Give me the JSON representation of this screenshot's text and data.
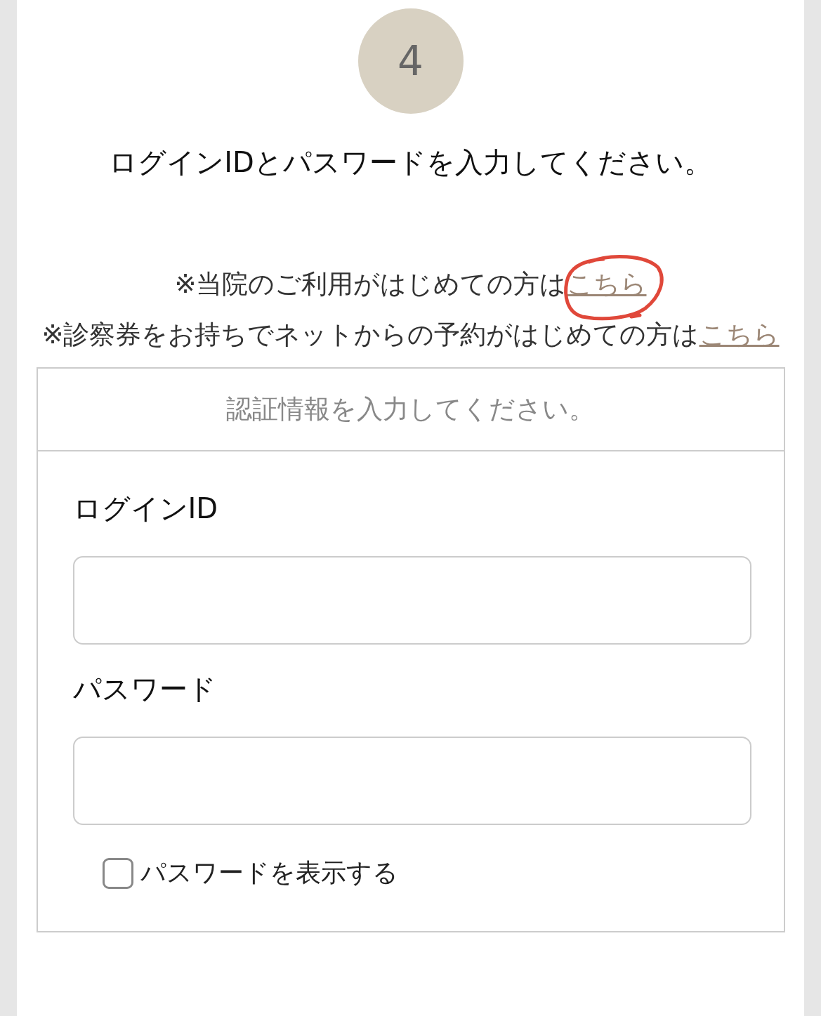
{
  "step": {
    "number": "4"
  },
  "heading": "ログインIDとパスワードを入力してください。",
  "notices": [
    {
      "text": "※当院のご利用がはじめての方は",
      "link": "こちら",
      "circled": true
    },
    {
      "text": "※診察券をお持ちでネットからの予約がはじめての方は",
      "link": "こちら",
      "circled": false
    }
  ],
  "form": {
    "title": "認証情報を入力してください。",
    "fields": [
      {
        "label": "ログインID"
      },
      {
        "label": "パスワード"
      }
    ],
    "show_password": {
      "label": "パスワードを表示する",
      "checked": false
    }
  }
}
